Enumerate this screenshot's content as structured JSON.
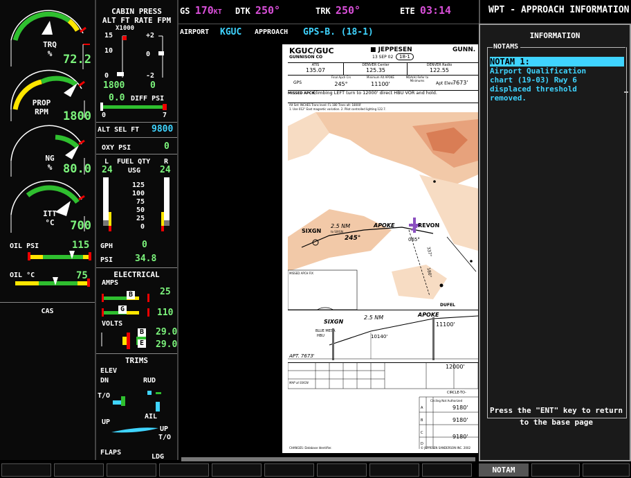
{
  "topbar": {
    "gs_label": "GS",
    "gs_value": "170",
    "gs_unit": "KT",
    "dtk_label": "DTK",
    "dtk_value": "250°",
    "trk_label": "TRK",
    "trk_value": "250°",
    "ete_label": "ETE",
    "ete_value": "03:14",
    "page_title": "WPT - APPROACH INFORMATION"
  },
  "subbar": {
    "airport_label": "AIRPORT",
    "airport_value": "KGUC",
    "approach_label": "APPROACH",
    "approach_value": "GPS-B. (18-1)"
  },
  "eis": {
    "trq": {
      "label1": "TRQ",
      "label2": "%",
      "value": "72.2"
    },
    "prop": {
      "label1": "PROP",
      "label2": "RPM",
      "value": "1800"
    },
    "ng": {
      "label1": "NG",
      "label2": "%",
      "value": "80.0"
    },
    "itt": {
      "label1": "ITT",
      "label2": "°C",
      "value": "700"
    },
    "oil_psi": {
      "label": "OIL PSI",
      "value": "115"
    },
    "oil_c": {
      "label": "OIL °C",
      "value": "75"
    },
    "cas_label": "CAS"
  },
  "eis2": {
    "cabin_title": "CABIN PRESS",
    "cabin_sub": "ALT FT RATE FPM",
    "cabin_mult": "X1000",
    "alt_scale": [
      "15",
      "10",
      "0"
    ],
    "rate_scale": [
      "+2",
      "0",
      "-2"
    ],
    "cabin_alt": "1800",
    "cabin_rate": "0",
    "diff_value": "0.0",
    "diff_label": "DIFF PSI",
    "diff_scale": [
      "0",
      "7"
    ],
    "alt_sel_label": "ALT SEL FT",
    "alt_sel_value": "9800",
    "oxy_label": "OXY PSI",
    "oxy_value": "0",
    "fuel_l": "L",
    "fuel_title": "FUEL QTY",
    "fuel_r": "R",
    "fuel_left": "24",
    "fuel_unit": "USG",
    "fuel_right": "24",
    "fuel_scale": [
      "125",
      "100",
      "75",
      "50",
      "25",
      "0"
    ],
    "gph_label": "GPH",
    "gph_value": "0",
    "psi_label": "PSI",
    "psi_value": "34.8",
    "elec_title": "ELECTRICAL",
    "amps_label": "AMPS",
    "amps_b": "B",
    "amps_b_val": "25",
    "amps_g": "G",
    "amps_g_val": "110",
    "volts_label": "VOLTS",
    "volts_b": "B",
    "volts_b_val": "29.0",
    "volts_e": "E",
    "volts_e_val": "29.0",
    "trims_title": "TRIMS",
    "elev_label": "ELEV",
    "dn_label": "DN",
    "rud_label": "RUD",
    "to_label": "T/O",
    "ail_label": "AIL",
    "up_label": "UP",
    "up2_label": "UP",
    "to2_label": "T/O",
    "flaps_label": "FLAPS",
    "ldg_label": "LDG"
  },
  "info": {
    "title": "INFORMATION",
    "notams_label": "NOTAMS",
    "notam_heading": "NOTAM 1:",
    "notam_lines": [
      "Airport Qualification",
      "chart (19-03) Rwy 6",
      "displaced threshold",
      "removed."
    ],
    "footer": "Press the \"ENT\" key to return to the base page"
  },
  "plate": {
    "ident": "KGUC/GUC",
    "city": "GUNNISON CO",
    "brand": "JEPPESEN",
    "date": "13 SEP 02",
    "proc_no": "18-1",
    "city_short": "GUNN.",
    "freq1_label": "ATIS",
    "freq1": "135.07",
    "freq2_label": "DENVER Center",
    "freq2": "125.35",
    "freq3_label": "DENVER Radio",
    "freq3": "122.55",
    "gps_label": "GPS",
    "final_label": "Final Apch Crs",
    "final_crs": "245°",
    "min_alt_label": "Minimum Alt APOKE",
    "min_alt": "11100'",
    "mda_label": "MDA(H) Refer to Minimums",
    "apt_elev_label": "Apt Elev",
    "apt_elev": "7673'",
    "missed_label": "MISSED APCH:",
    "missed_text": "Climbing LEFT turn to 12000' direct HBU VOR and hold.",
    "notes": "Alt Set: INCHES   Trans level: FL 180   Trans alt: 18000'",
    "notes2": "1. Use 012° East magnetic variation. 2. Pilot controlled lighting 122.7.",
    "wp_sixgn": "SIXGN",
    "wp_apoke": "APOKE",
    "wp_revon": "REVON",
    "wp_dufel": "DUFEL",
    "wp_bluemesa": "BLUE MESA",
    "wp_hbu": "HBU",
    "missed_fix": "MISSED APCH FIX",
    "dist_25": "2.5 NM",
    "to_sixgn": "to SIXGN",
    "crs_245": "245°",
    "crs_065": "065°",
    "crs_337": "337°",
    "crs_180": "180°",
    "elev_10140": "10140'",
    "alt_11100": "11100'",
    "alt_12000": "12000'",
    "tdze": "APT. 7673'",
    "maps_sixgn": "MAP at SIXGN",
    "circle_label": "CIRCLE-TO-",
    "circling_label": "Circling Not Authorized",
    "mins": [
      "9180'",
      "9180'",
      "9180'"
    ],
    "cat_a": "A",
    "cat_b": "B",
    "cat_c": "C",
    "cat_d": "D",
    "footer_left": "CHANGES: Database Identifier.",
    "footer_right": "© JEPPESEN SANDERSON INC. 2002"
  },
  "softkeys": {
    "notam": "NOTAM"
  }
}
